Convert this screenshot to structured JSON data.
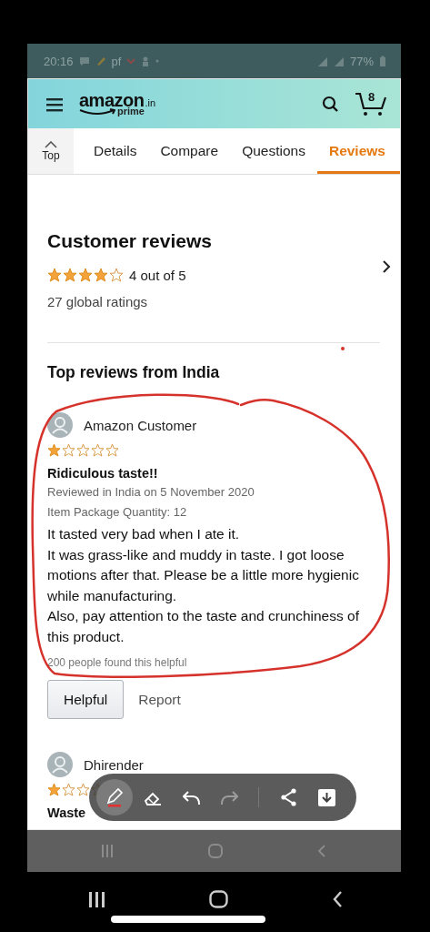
{
  "status_bar": {
    "time": "20:16",
    "carrier_text": "pf",
    "battery": "77%"
  },
  "header": {
    "logo": "amazon",
    "logo_suffix": ".in",
    "logo_sub": "prime",
    "cart_count": "8"
  },
  "tabs": [
    {
      "label": "Top",
      "kind": "top",
      "selected": false
    },
    {
      "label": "Details",
      "kind": "text",
      "selected": false
    },
    {
      "label": "Compare",
      "kind": "text",
      "selected": false
    },
    {
      "label": "Questions",
      "kind": "text",
      "selected": false
    },
    {
      "label": "Reviews",
      "kind": "text",
      "selected": true
    }
  ],
  "summary": {
    "title": "Customer reviews",
    "stars": 4,
    "rating_text": "4 out of 5",
    "ratings_count": "27 global ratings"
  },
  "top_reviews": {
    "title": "Top reviews from India",
    "reviews": [
      {
        "author": "Amazon Customer",
        "stars": 1,
        "title": "Ridiculous taste!!",
        "meta": [
          "Reviewed in India on 5 November 2020",
          "Item Package Quantity: 12"
        ],
        "body": [
          "It tasted very bad when I ate it.",
          "It was grass-like and muddy in taste. I got loose motions after that. Please be a little more hygienic while manufacturing.",
          "Also, pay attention to the taste and crunchiness of this product."
        ],
        "helpful_count": "200 people found this helpful",
        "buttons": [
          "Helpful",
          "Report"
        ]
      },
      {
        "author": "Dhirender",
        "stars": 1,
        "title": "Waste"
      }
    ]
  },
  "editor_toolbar": {
    "tools": [
      {
        "kind": "pen",
        "selected": true,
        "disabled": false
      },
      {
        "kind": "eraser",
        "selected": false,
        "disabled": false
      },
      {
        "kind": "undo",
        "selected": false,
        "disabled": false
      },
      {
        "kind": "redo",
        "selected": false,
        "disabled": true
      },
      {
        "kind": "share",
        "selected": false,
        "disabled": false
      },
      {
        "kind": "download",
        "selected": false,
        "disabled": false
      }
    ]
  }
}
